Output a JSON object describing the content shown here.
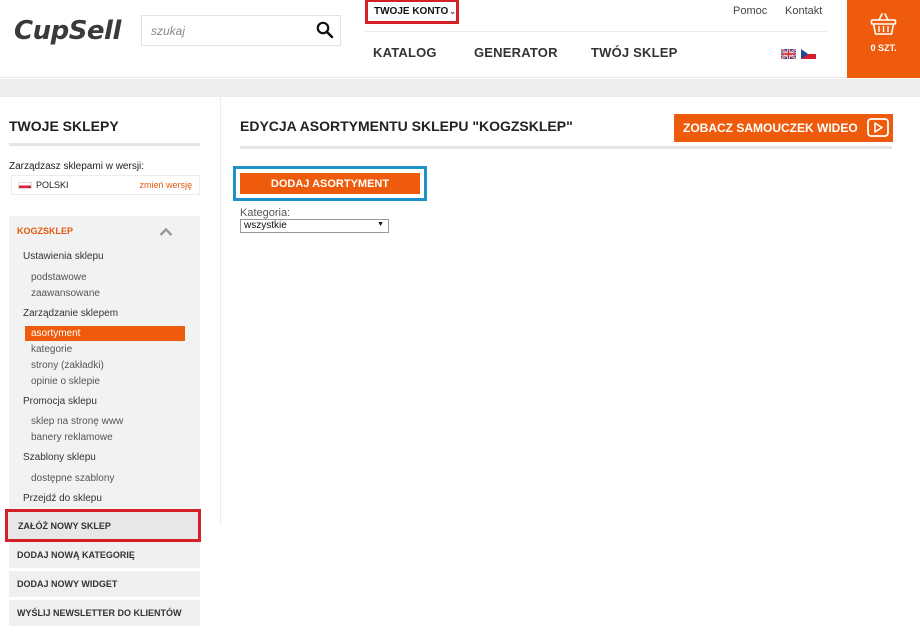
{
  "header": {
    "logo": "CupSell",
    "search_placeholder": "szukaj",
    "account_label": "TWOJE KONTO",
    "help": "Pomoc",
    "contact": "Kontakt",
    "nav": [
      "KATALOG",
      "GENERATOR",
      "TWÓJ SKLEP"
    ],
    "cart_count": "0 SZT."
  },
  "sidebar": {
    "title": "TWOJE SKLEPY",
    "version_label": "Zarządzasz sklepami w wersji:",
    "version_lang": "POLSKI",
    "version_change": "zmień wersję",
    "shop_name": "KOGZSKLEP",
    "menu": [
      {
        "label": "Ustawienia sklepu",
        "sub": [
          "podstawowe",
          "zaawansowane"
        ]
      },
      {
        "label": "Zarządzanie sklepem",
        "sub": [
          "asortyment",
          "kategorie",
          "strony (zakładki)",
          "opinie o sklepie"
        ]
      },
      {
        "label": "Promocja sklepu",
        "sub": [
          "sklep na stronę www",
          "banery reklamowe"
        ]
      },
      {
        "label": "Szablony sklepu",
        "sub": [
          "dostępne szablony"
        ]
      },
      {
        "label": "Przejdź do sklepu",
        "sub": []
      }
    ],
    "actions": [
      "ZAŁÓŻ NOWY SKLEP",
      "DODAJ NOWĄ KATEGORIĘ",
      "DODAJ NOWY WIDGET",
      "WYŚLIJ NEWSLETTER DO KLIENTÓW"
    ]
  },
  "main": {
    "title": "EDYCJA ASORTYMENTU SKLEPU \"KOGZSKLEP\"",
    "video_button": "ZOBACZ SAMOUCZEK WIDEO",
    "add_button": "DODAJ ASORTYMENT",
    "category_label": "Kategoria:",
    "category_value": "wszystkie"
  },
  "colors": {
    "accent": "#ef5b0c",
    "highlight_red": "#d32027",
    "highlight_blue": "#1d93c7"
  }
}
